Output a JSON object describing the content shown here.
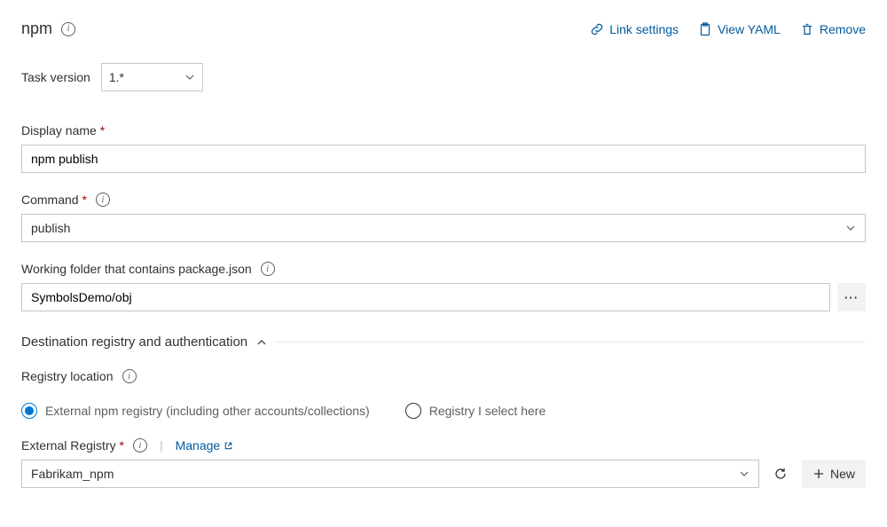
{
  "header": {
    "title": "npm",
    "actions": {
      "link_settings": "Link settings",
      "view_yaml": "View YAML",
      "remove": "Remove"
    }
  },
  "task_version": {
    "label": "Task version",
    "value": "1.*"
  },
  "display_name": {
    "label": "Display name",
    "value": "npm publish"
  },
  "command": {
    "label": "Command",
    "value": "publish"
  },
  "working_folder": {
    "label": "Working folder that contains package.json",
    "value": "SymbolsDemo/obj"
  },
  "section": {
    "title": "Destination registry and authentication"
  },
  "registry_location": {
    "label": "Registry location",
    "options": {
      "external": "External npm registry (including other accounts/collections)",
      "select_here": "Registry I select here"
    },
    "selected": "external"
  },
  "external_registry": {
    "label": "External Registry",
    "manage": "Manage",
    "value": "Fabrikam_npm",
    "new_button": "New"
  }
}
